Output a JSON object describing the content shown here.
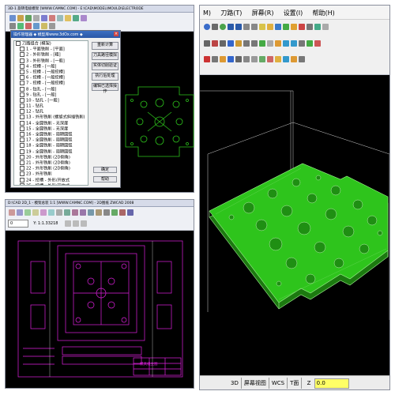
{
  "top_left": {
    "title": "3D-1 旋转电极模架 [WWW.CAMNC.COM] - E:\\CAD\\MODEL\\MOULD\\ELECTRODE",
    "dialog": {
      "title": "操作管理器 ◆ 模型库www.3dOx.com ◆",
      "root": "刀路组合 (模架)",
      "items": [
        "1 - 平面铣削 - [平面]",
        "2 - 外形铣削 - [粗]",
        "3 - 外形铣削 - [一般]",
        "4 - 挖槽 - [一般]",
        "5 - 挖槽 - [一般挖槽]",
        "6 - 挖槽 - [一般挖槽]",
        "7 - 挖槽 - [一般挖槽]",
        "8 - 钻孔 - [一般]",
        "9 - 钻孔 - [一般]",
        "10 - 钻孔 - [一般]",
        "11 - 钻孔",
        "12 - 钻孔",
        "13 - 外形铣削 (螺旋式斜插铣削)",
        "14 - 全圆铣削 - 无深度",
        "15 - 全圆铣削 - 无深度",
        "16 - 全圆铣削 - 周期圆弧",
        "17 - 全圆铣削 - 周期圆弧",
        "18 - 全圆铣削 - 周期圆弧",
        "19 - 全圆铣削 - 周期圆弧",
        "20 - 外形铣削 (2D倒角)",
        "21 - 外形铣削 (2D倒角)",
        "22 - 外形铣削 (2D倒角)",
        "23 - 外形铣削",
        "24 - 挖槽 - 外形/开放式",
        "25 - 挖槽 - 外形/开放式",
        "26 - 钻孔 - 使用平刀",
        "27 - 钻孔",
        "28 - 外形铣削",
        "29 - 外形铣削 (2D)",
        "30 - 外形铣削 (2D)",
        "31 - 外形铣削 (2D)",
        "32 - 外形铣削 (2D)"
      ],
      "buttons": [
        "重新计算",
        "刀具路径模拟",
        "实体切削验证",
        "执行后处理",
        "编辑已选择操作"
      ],
      "ok": "确定",
      "help": "帮助"
    }
  },
  "bottom_left": {
    "title": "D:\\CAD 2D_1 - 模架总装 1:1 [WWW.CAMNC.COM] - 2D图纸 ZWCAD 2008",
    "layer": "0",
    "status": "Y: 1:1.33218",
    "drawing_label": "模具组立图"
  },
  "right": {
    "menu": [
      "M)",
      "刀路(T)",
      "屏幕(R)",
      "设置(I)",
      "帮助(H)"
    ],
    "statusbar": {
      "mode": "3D",
      "view": "屏幕视图",
      "wcs": "WCS",
      "plane": "T面",
      "z_label": "Z",
      "z_value": "0.0"
    }
  },
  "colors": {
    "cad_bg": "#000000",
    "geometry_green": "#2ec41c",
    "geometry_magenta": "#e020e0",
    "viewport_bg": "#ffffff"
  }
}
